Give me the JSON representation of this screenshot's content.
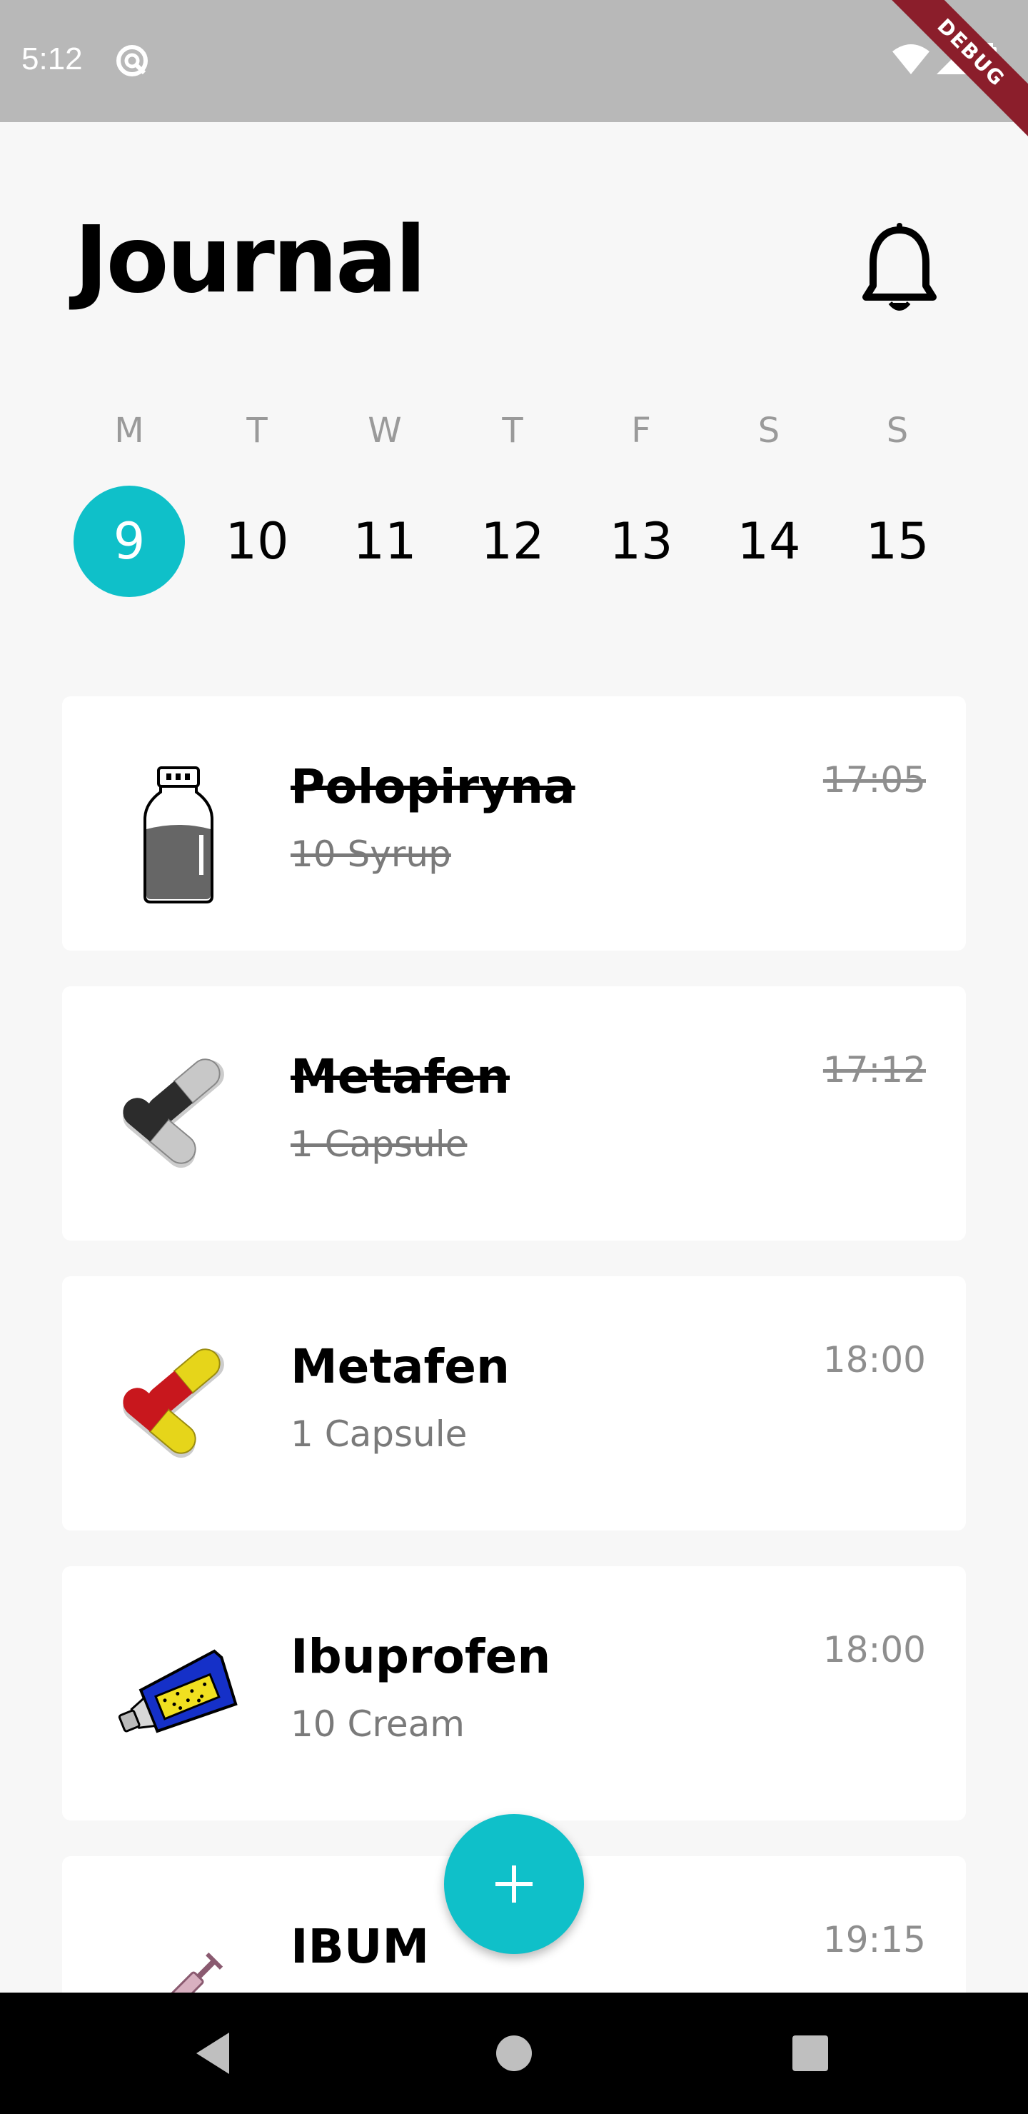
{
  "status_bar": {
    "time": "5:12",
    "debug_label": "DEBUG"
  },
  "header": {
    "title": "Journal"
  },
  "week": {
    "days": [
      "M",
      "T",
      "W",
      "T",
      "F",
      "S",
      "S"
    ],
    "dates": [
      "9",
      "10",
      "11",
      "12",
      "13",
      "14",
      "15"
    ],
    "selected_index": 0
  },
  "entries": [
    {
      "name": "Polopiryna",
      "dose": "10 Syrup",
      "time": "17:05",
      "taken": true,
      "icon": "syrup-bottle-icon"
    },
    {
      "name": "Metafen",
      "dose": "1 Capsule",
      "time": "17:12",
      "taken": true,
      "icon": "gray-capsules-icon"
    },
    {
      "name": "Metafen",
      "dose": "1 Capsule",
      "time": "18:00",
      "taken": false,
      "icon": "red-yellow-capsules-icon"
    },
    {
      "name": "Ibuprofen",
      "dose": "10 Cream",
      "time": "18:00",
      "taken": false,
      "icon": "cream-tube-icon"
    },
    {
      "name": "IBUM",
      "dose": "",
      "time": "19:15",
      "taken": false,
      "icon": "syringe-icon"
    }
  ],
  "colors": {
    "accent": "#0fc0c9",
    "debug_ribbon": "#8b1e2b"
  }
}
